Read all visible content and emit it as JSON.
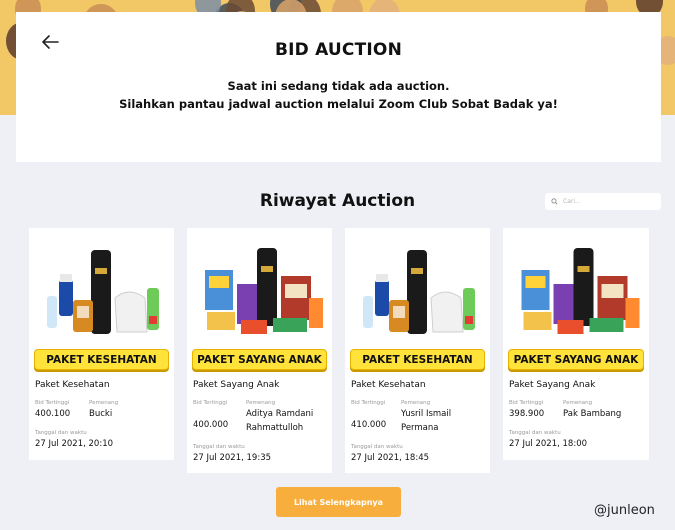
{
  "header": {
    "title": "BID AUCTION",
    "message_line1": "Saat ini sedang tidak ada auction.",
    "message_line2": "Silahkan pantau jadwal auction melalui Zoom Club Sobat Badak ya!"
  },
  "history": {
    "title": "Riwayat Auction",
    "search_placeholder": "Cari..."
  },
  "cards": [
    {
      "banner": "PAKET KESEHATAN",
      "name": "Paket Kesehatan",
      "bid_label": "Bid Tertinggi",
      "bid": "400.100",
      "winner_label": "Pemenang",
      "winner": "Bucki",
      "date_label": "Tanggal dan waktu",
      "date": "27 Jul 2021, 20:10"
    },
    {
      "banner": "PAKET SAYANG ANAK",
      "name": "Paket Sayang Anak",
      "bid_label": "Bid Tertinggi",
      "bid": "400.000",
      "winner_label": "Pemenang",
      "winner": "Aditya Ramdani Rahmattulloh",
      "date_label": "Tanggal dan waktu",
      "date": "27 Jul 2021, 19:35"
    },
    {
      "banner": "PAKET KESEHATAN",
      "name": "Paket Kesehatan",
      "bid_label": "Bid Tertinggi",
      "bid": "410.000",
      "winner_label": "Pemenang",
      "winner": "Yusril Ismail Permana",
      "date_label": "Tanggal dan waktu",
      "date": "27 Jul 2021, 18:45"
    },
    {
      "banner": "PAKET SAYANG ANAK",
      "name": "Paket Sayang Anak",
      "bid_label": "Bid Tertinggi",
      "bid": "398.900",
      "winner_label": "Pemenang",
      "winner": "Pak Bambang",
      "date_label": "Tanggal dan waktu",
      "date": "27 Jul 2021, 18:00"
    }
  ],
  "more_button": "Lihat Selengkapnya",
  "watermark": "@junleon",
  "icons": {
    "back": "arrow-left-icon",
    "search": "search-icon"
  },
  "colors": {
    "accent": "#f7ae3c",
    "banner": "#ffe23a",
    "background": "#eef0f6"
  }
}
